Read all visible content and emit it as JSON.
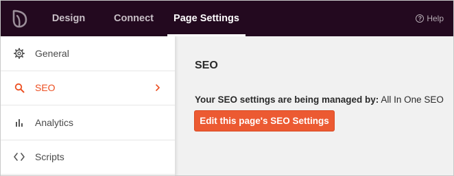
{
  "topbar": {
    "logo_icon": "leaf-logo-icon",
    "tabs": [
      {
        "label": "Design"
      },
      {
        "label": "Connect"
      },
      {
        "label": "Page Settings",
        "active": true
      }
    ],
    "help": {
      "icon": "help-circle-icon",
      "glyph": "?",
      "label": "Help"
    }
  },
  "sidebar": {
    "items": [
      {
        "label": "General",
        "icon": "gear-icon"
      },
      {
        "label": "SEO",
        "icon": "search-icon",
        "active": true,
        "chevron": "chevron-right-icon"
      },
      {
        "label": "Analytics",
        "icon": "bar-chart-icon"
      },
      {
        "label": "Scripts",
        "icon": "code-icon"
      }
    ]
  },
  "main": {
    "title": "SEO",
    "managed_by_label": "Your SEO settings are being managed by:",
    "managed_by_value": "All In One SEO",
    "edit_button_label": "Edit this page's SEO Settings"
  },
  "colors": {
    "topbar_bg": "#23091f",
    "accent": "#ec5a32",
    "active_text": "#ec4e20",
    "content_bg": "#f1f1f1"
  }
}
